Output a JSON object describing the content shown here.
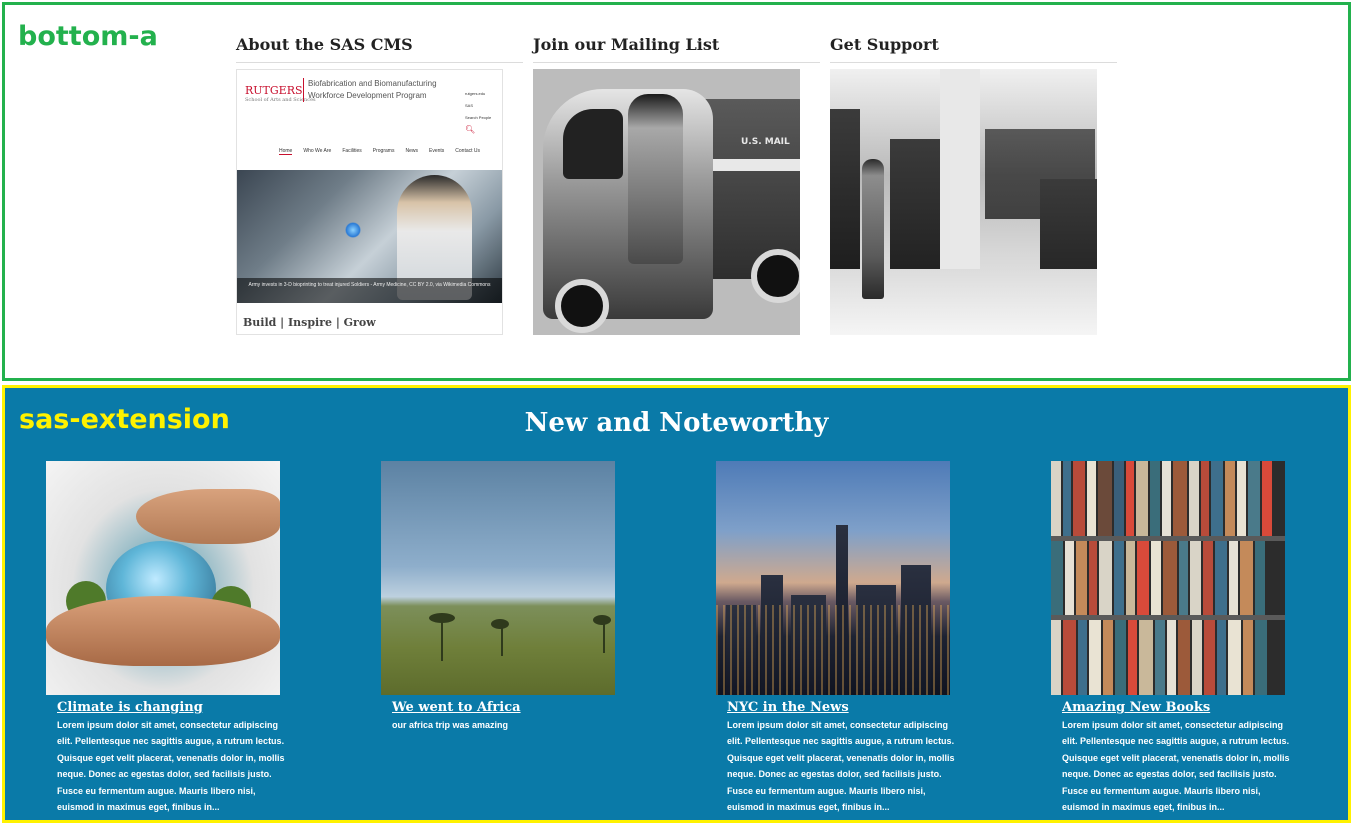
{
  "region_a": {
    "label": "bottom-a",
    "blocks": [
      {
        "title": "About the SAS CMS",
        "cms_logo": "RUTGERS",
        "cms_logo_sub": "School of Arts and Sciences",
        "cms_program": "Biofabrication and Biomanufacturing Workforce Development Program",
        "cms_util": [
          "rutgers.edu",
          "SAS",
          "Search People"
        ],
        "cms_nav": [
          "Home",
          "Who We Are",
          "Facilities",
          "Programs",
          "News",
          "Events",
          "Contact Us"
        ],
        "cms_caption": "Army invests in 3-D bioprinting to treat injured Soldiers - Army Medicine, CC BY 2.0, via Wikimedia Commons",
        "cms_tagline": "Build | Inspire | Grow"
      },
      {
        "title": "Join our Mailing List",
        "image_text": "U.S. MAIL"
      },
      {
        "title": "Get Support"
      }
    ]
  },
  "region_b": {
    "label": "sas-extension",
    "title": "New and Noteworthy",
    "cards": [
      {
        "title": "Climate is changing",
        "text": "Lorem ipsum dolor sit amet, consectetur adipiscing elit. Pellentesque nec sagittis augue, a rutrum lectus. Quisque eget velit placerat, venenatis dolor in, mollis neque. Donec ac egestas dolor, sed facilisis justo. Fusce eu fermentum augue. Mauris libero nisi, euismod in maximus eget, finibus in..."
      },
      {
        "title": "We went to Africa",
        "text": "our africa trip was amazing"
      },
      {
        "title": "NYC in the News",
        "text": "Lorem ipsum dolor sit amet, consectetur adipiscing elit. Pellentesque nec sagittis augue, a rutrum lectus. Quisque eget velit placerat, venenatis dolor in, mollis neque. Donec ac egestas dolor, sed facilisis justo. Fusce eu fermentum augue. Mauris libero nisi, euismod in maximus eget, finibus in..."
      },
      {
        "title": "Amazing New Books",
        "text": "Lorem ipsum dolor sit amet, consectetur adipiscing elit. Pellentesque nec sagittis augue, a rutrum lectus. Quisque eget velit placerat, venenatis dolor in, mollis neque. Donec ac egestas dolor, sed facilisis justo. Fusce eu fermentum augue. Mauris libero nisi, euismod in maximus eget, finibus in..."
      }
    ]
  },
  "colors": {
    "region_a_border": "#23b14d",
    "region_b_border": "#fff200",
    "region_b_background": "#0a7aa8",
    "brand_red": "#c8102e"
  }
}
